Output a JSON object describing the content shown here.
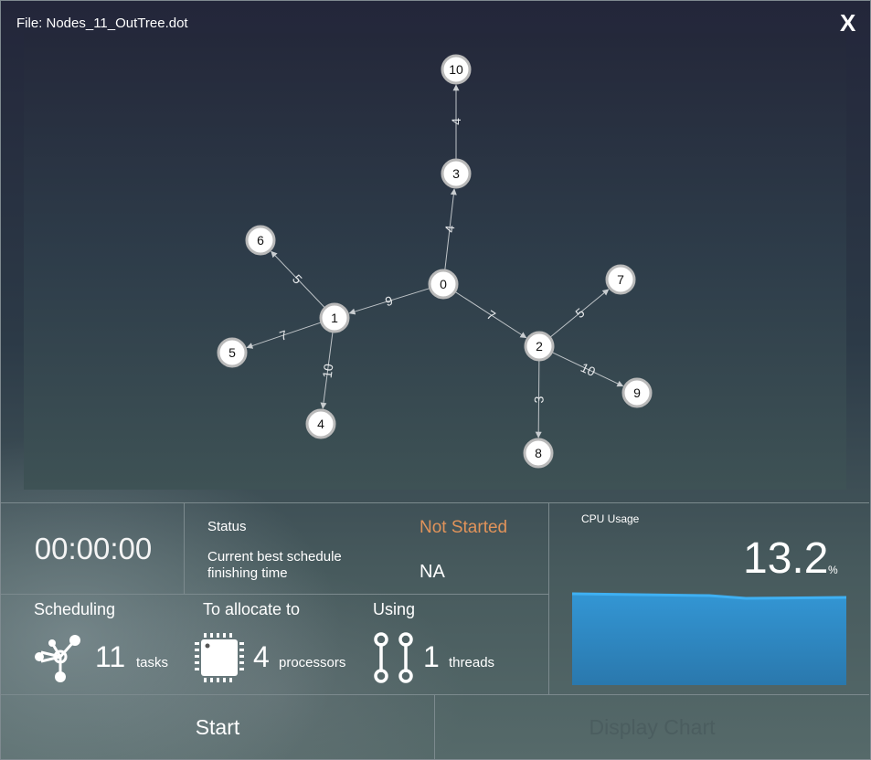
{
  "header": {
    "file_label": "File:  Nodes_11_OutTree.dot",
    "close_label": "X"
  },
  "graph": {
    "nodes": [
      {
        "id": "0",
        "label": "0"
      },
      {
        "id": "1",
        "label": "1"
      },
      {
        "id": "2",
        "label": "2"
      },
      {
        "id": "3",
        "label": "3"
      },
      {
        "id": "4",
        "label": "4"
      },
      {
        "id": "5",
        "label": "5"
      },
      {
        "id": "6",
        "label": "6"
      },
      {
        "id": "7",
        "label": "7"
      },
      {
        "id": "8",
        "label": "8"
      },
      {
        "id": "9",
        "label": "9"
      },
      {
        "id": "10",
        "label": "10"
      }
    ],
    "edges": [
      {
        "from": "0",
        "to": "3",
        "weight": "4"
      },
      {
        "from": "3",
        "to": "10",
        "weight": "4"
      },
      {
        "from": "0",
        "to": "1",
        "weight": "9"
      },
      {
        "from": "0",
        "to": "2",
        "weight": "7"
      },
      {
        "from": "1",
        "to": "6",
        "weight": "5"
      },
      {
        "from": "1",
        "to": "5",
        "weight": "7"
      },
      {
        "from": "1",
        "to": "4",
        "weight": "10"
      },
      {
        "from": "2",
        "to": "7",
        "weight": "5"
      },
      {
        "from": "2",
        "to": "9",
        "weight": "10"
      },
      {
        "from": "2",
        "to": "8",
        "weight": "3"
      }
    ]
  },
  "timer": {
    "value": "00:00:00"
  },
  "status": {
    "label": "Status",
    "value": "Not Started",
    "value_color": "#e1935a",
    "best_label": "Current best schedule finishing time",
    "best_value": "NA"
  },
  "stats": {
    "scheduling": {
      "title": "Scheduling",
      "count": "11",
      "unit": "tasks",
      "icon": "network-nodes-icon"
    },
    "allocate": {
      "title": "To allocate to",
      "count": "4",
      "unit": "processors",
      "icon": "cpu-chip-icon"
    },
    "using": {
      "title": "Using",
      "count": "1",
      "unit": "threads",
      "icon": "threads-icon"
    }
  },
  "cpu": {
    "label": "CPU Usage",
    "value": "13.2",
    "unit": "%",
    "fill_color": "#2e8ec9",
    "line_color": "#3aa6ea"
  },
  "buttons": {
    "start": "Start",
    "display_chart": "Display Chart"
  }
}
